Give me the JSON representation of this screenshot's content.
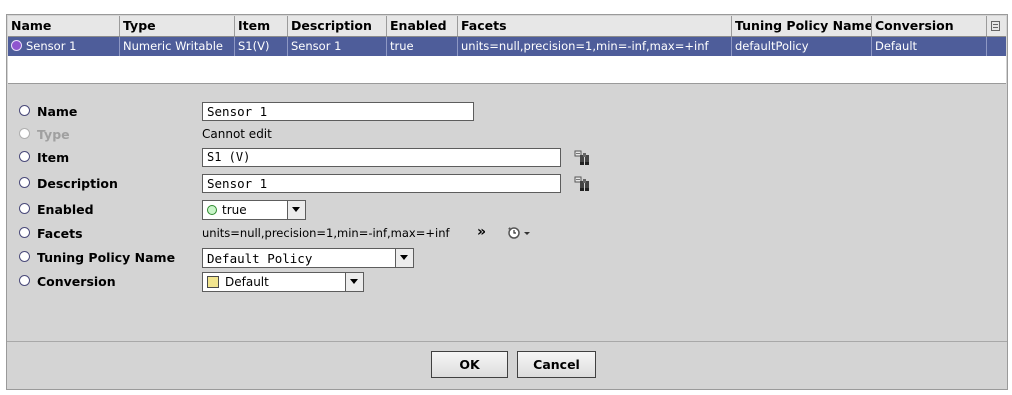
{
  "table": {
    "columns": [
      "Name",
      "Type",
      "Item",
      "Description",
      "Enabled",
      "Facets",
      "Tuning Policy Name",
      "Conversion"
    ],
    "rows": [
      [
        "Sensor 1",
        "Numeric Writable",
        "S1(V)",
        "Sensor 1",
        "true",
        "units=null,precision=1,min=-inf,max=+inf",
        "defaultPolicy",
        "Default"
      ]
    ]
  },
  "form": {
    "name": {
      "label": "Name",
      "value": "Sensor 1"
    },
    "type": {
      "label": "Type",
      "value": "Cannot edit"
    },
    "item": {
      "label": "Item",
      "value": "S1 (V)"
    },
    "description": {
      "label": "Description",
      "value": "Sensor 1"
    },
    "enabled": {
      "label": "Enabled",
      "value": "true"
    },
    "facets": {
      "label": "Facets",
      "value": "units=null,precision=1,min=-inf,max=+inf",
      "more": "»"
    },
    "tuning_policy": {
      "label": "Tuning Policy Name",
      "value": "Default Policy"
    },
    "conversion": {
      "label": "Conversion",
      "value": "Default"
    }
  },
  "buttons": {
    "ok": "OK",
    "cancel": "Cancel"
  },
  "colors": {
    "selection": "#4e5d9a",
    "radio_selected": "#8f55cf",
    "panel": "#d4d4d4"
  },
  "icons": [
    "column-chooser-icon",
    "binoculars-icon",
    "history-clock-icon",
    "dropdown-arrow-icon"
  ]
}
